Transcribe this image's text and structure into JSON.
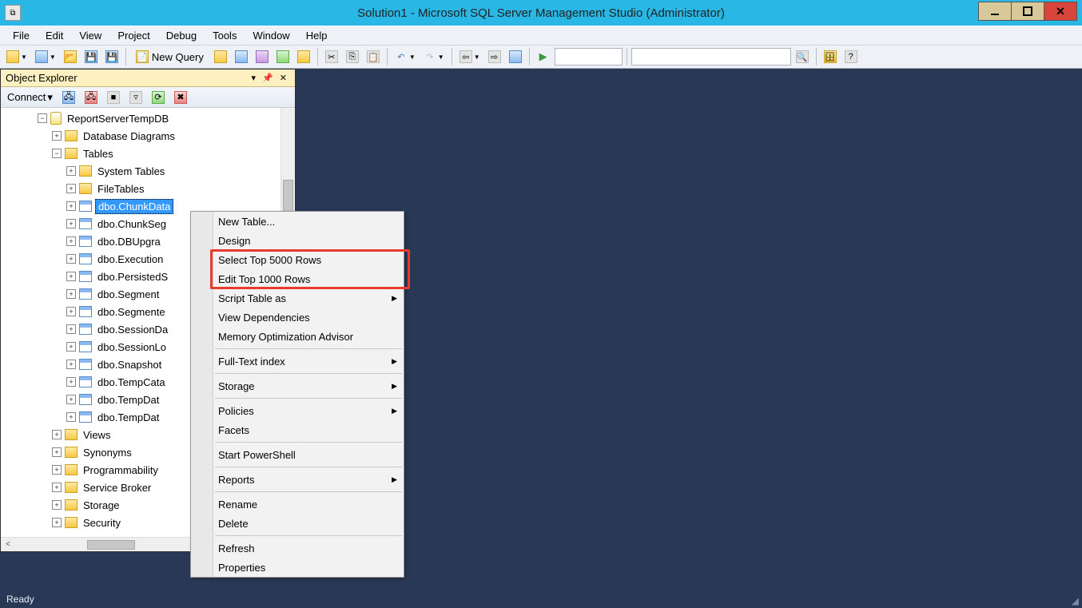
{
  "window": {
    "title": "Solution1 - Microsoft SQL Server Management Studio (Administrator)"
  },
  "menubar": [
    "File",
    "Edit",
    "View",
    "Project",
    "Debug",
    "Tools",
    "Window",
    "Help"
  ],
  "toolbar": {
    "new_query": "New Query"
  },
  "object_explorer": {
    "title": "Object Explorer",
    "connect_label": "Connect",
    "tree": {
      "db": "ReportServerTempDB",
      "nodes": {
        "database_diagrams": "Database Diagrams",
        "tables": "Tables",
        "system_tables": "System Tables",
        "file_tables": "FileTables",
        "views": "Views",
        "synonyms": "Synonyms",
        "programmability": "Programmability",
        "service_broker": "Service Broker",
        "storage": "Storage",
        "security": "Security"
      },
      "table_items": [
        "dbo.ChunkData",
        "dbo.ChunkSeg",
        "dbo.DBUpgra",
        "dbo.Execution",
        "dbo.PersistedS",
        "dbo.Segment",
        "dbo.Segmente",
        "dbo.SessionDa",
        "dbo.SessionLo",
        "dbo.Snapshot",
        "dbo.TempCata",
        "dbo.TempDat",
        "dbo.TempDat"
      ]
    }
  },
  "context_menu": {
    "new_table": "New Table...",
    "design": "Design",
    "select_top": "Select Top 5000 Rows",
    "edit_top": "Edit Top 1000 Rows",
    "script_table": "Script Table as",
    "view_deps": "View Dependencies",
    "mem_opt": "Memory Optimization Advisor",
    "fulltext": "Full-Text index",
    "storage": "Storage",
    "policies": "Policies",
    "facets": "Facets",
    "powershell": "Start PowerShell",
    "reports": "Reports",
    "rename": "Rename",
    "delete": "Delete",
    "refresh": "Refresh",
    "properties": "Properties"
  },
  "statusbar": {
    "ready": "Ready"
  }
}
